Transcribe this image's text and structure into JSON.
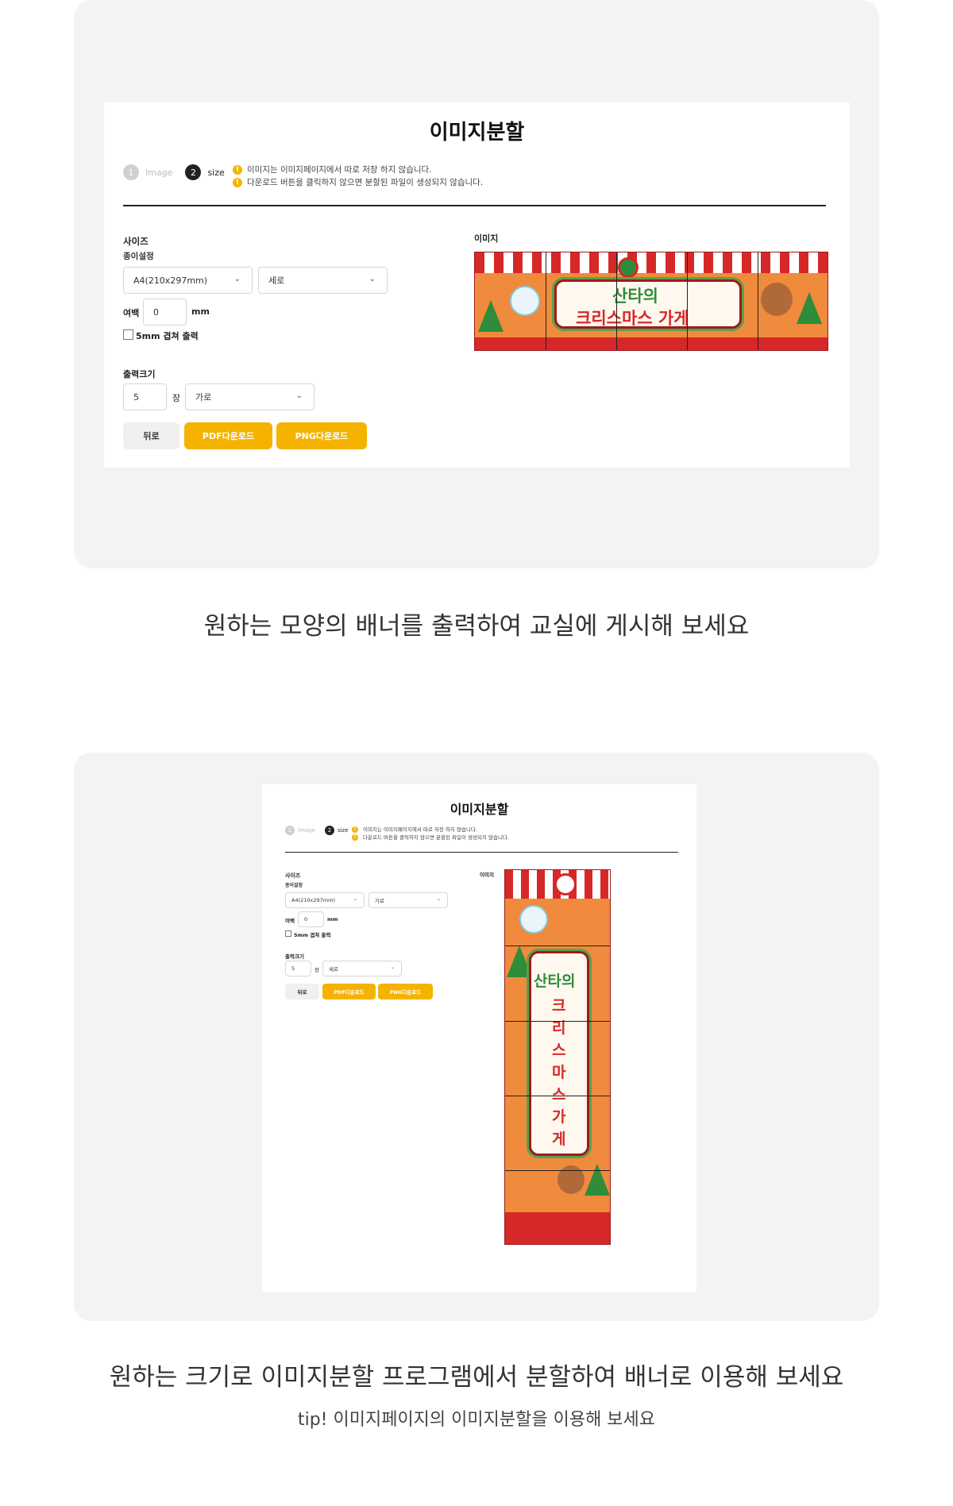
{
  "app": {
    "title": "이미지분할",
    "steps": [
      {
        "num": "1",
        "label": "Image"
      },
      {
        "num": "2",
        "label": "size"
      }
    ],
    "notices": [
      "이미지는 이미지페이지에서 따로 저장 하지 않습니다.",
      "다운로드 버튼을 클릭하지 않으면 분할된 파일이 생성되지 않습니다."
    ],
    "warn_icon": "!",
    "size_label": "사이즈",
    "paper_label": "종이설정",
    "paper_value": "A4(210x297mm)",
    "margin_label": "여백",
    "margin_value": "0",
    "margin_unit": "mm",
    "overlap_label": "5mm 겹쳐 출력",
    "output_label": "출력크기",
    "output_count": "5",
    "output_unit": "장",
    "back_label": "뒤로",
    "pdf_label": "PDF다운로드",
    "png_label": "PNG다운로드",
    "image_label": "이미지",
    "chevron": "⌄"
  },
  "screen1": {
    "orientation": "세로",
    "direction": "가로",
    "banner": {
      "line1": "산타의",
      "line2": "크리스마스 가게"
    }
  },
  "screen2": {
    "orientation": "가로",
    "direction": "세로",
    "banner": {
      "line1": "산타의",
      "line2": "크리스마스가게"
    }
  },
  "captions": {
    "first": "원하는 모양의 배너를 출력하여 교실에 게시해 보세요",
    "second": "원하는 크기로 이미지분할 프로그램에서 분할하여 배너로 이용해 보세요",
    "tip": "tip! 이미지페이지의 이미지분할을 이용해 보세요"
  },
  "colors": {
    "accent": "#f5b300",
    "panel": "#f3f3f3",
    "banner_red": "#d62828",
    "banner_green": "#2f8c3a",
    "banner_orange": "#f08a3c"
  }
}
